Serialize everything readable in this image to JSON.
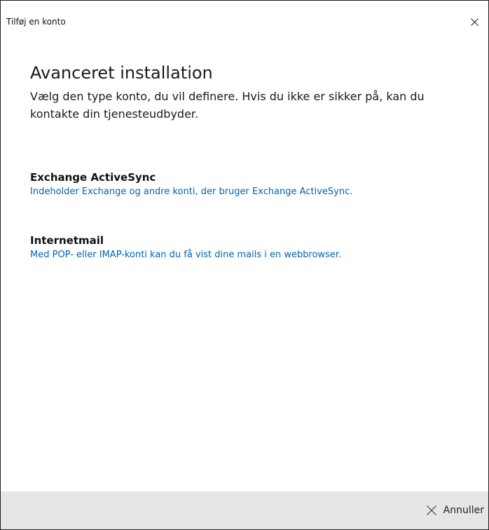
{
  "window": {
    "title": "Tilføj en konto"
  },
  "main": {
    "title": "Avanceret installation",
    "description": "Vælg den type konto, du vil definere. Hvis du ikke er sikker på, kan du kontakte din tjenesteudbyder."
  },
  "options": [
    {
      "title": "Exchange ActiveSync",
      "description": "Indeholder Exchange og andre konti, der bruger Exchange ActiveSync."
    },
    {
      "title": "Internetmail",
      "description": "Med POP- eller IMAP-konti kan du få vist dine mails i en webbrowser."
    }
  ],
  "footer": {
    "cancel_label": "Annuller"
  },
  "icons": {
    "close": "close-icon",
    "cancel": "close-icon"
  },
  "colors": {
    "link": "#0063b1",
    "footer_bg": "#e6e6e6",
    "text": "#1a1a1a"
  }
}
